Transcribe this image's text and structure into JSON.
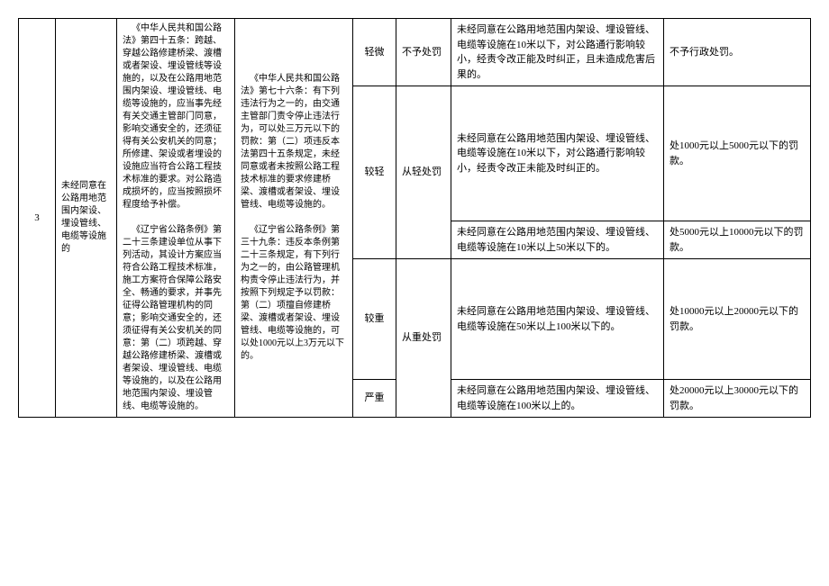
{
  "row": {
    "num": "3",
    "item": "未经同意在公路用地范围内架设、埋设管线、电缆等设施的",
    "law1": "《中华人民共和国公路法》第四十五条：跨越、穿越公路修建桥梁、渡槽或者架设、埋设管线等设施的，以及在公路用地范围内架设、埋设管线、电缆等设施的，应当事先经有关交通主管部门同意，影响交通安全的，还须征得有关公安机关的同意；所修建、架设或者埋设的设施应当符合公路工程技术标准的要求。对公路造成损坏的，应当按照损坏程度给予补偿。",
    "law1b": "《辽宁省公路条例》第二十三条建设单位从事下列活动，其设计方案应当符合公路工程技术标准，施工方案符合保障公路安全、畅通的要求，并事先征得公路管理机构的同意；影响交通安全的，还须征得有关公安机关的同意：第（二）项跨越、穿越公路修建桥梁、渡槽或者架设、埋设管线、电缆等设施的，以及在公路用地范围内架设、埋设管线、电缆等设施的。",
    "law2": "《中华人民共和国公路法》第七十六条：有下列违法行为之一的，由交通主管部门责令停止违法行为，可以处三万元以下的罚款：第（二）项违反本法第四十五条规定，未经同意或者未按照公路工程技术标准的要求修建桥梁、渡槽或者架设、埋设管线、电缆等设施的。",
    "law2b": "《辽宁省公路条例》第三十九条：违反本条例第二十三条规定，有下列行为之一的，由公路管理机构责令停止违法行为，并按照下列规定予以罚款：第（二）项擅自修建桥梁、渡槽或者架设、埋设管线、电缆等设施的，可以处1000元以上3万元以下的。",
    "levels": [
      {
        "severity": "轻微",
        "action": "不予处罚",
        "situation": "未经同意在公路用地范围内架设、埋设管线、电缆等设施在10米以下，对公路通行影响较小，经责令改正能及时纠正，且未造成危害后果的。",
        "penalty": "不予行政处罚。"
      },
      {
        "severity": "较轻",
        "action": "从轻处罚",
        "situation1": "未经同意在公路用地范围内架设、埋设管线、电缆等设施在10米以下，对公路通行影响较小，经责令改正未能及时纠正的。",
        "penalty1": "处1000元以上5000元以下的罚款。",
        "situation2": "未经同意在公路用地范围内架设、埋设管线、电缆等设施在10米以上50米以下的。",
        "penalty2": "处5000元以上10000元以下的罚款。"
      },
      {
        "severity": "较重",
        "action": "从重处罚",
        "situation": "未经同意在公路用地范围内架设、埋设管线、电缆等设施在50米以上100米以下的。",
        "penalty": "处10000元以上20000元以下的罚款。"
      },
      {
        "severity": "严重",
        "action": "",
        "situation": "未经同意在公路用地范围内架设、埋设管线、电缆等设施在100米以上的。",
        "penalty": "处20000元以上30000元以下的罚款。"
      }
    ]
  }
}
